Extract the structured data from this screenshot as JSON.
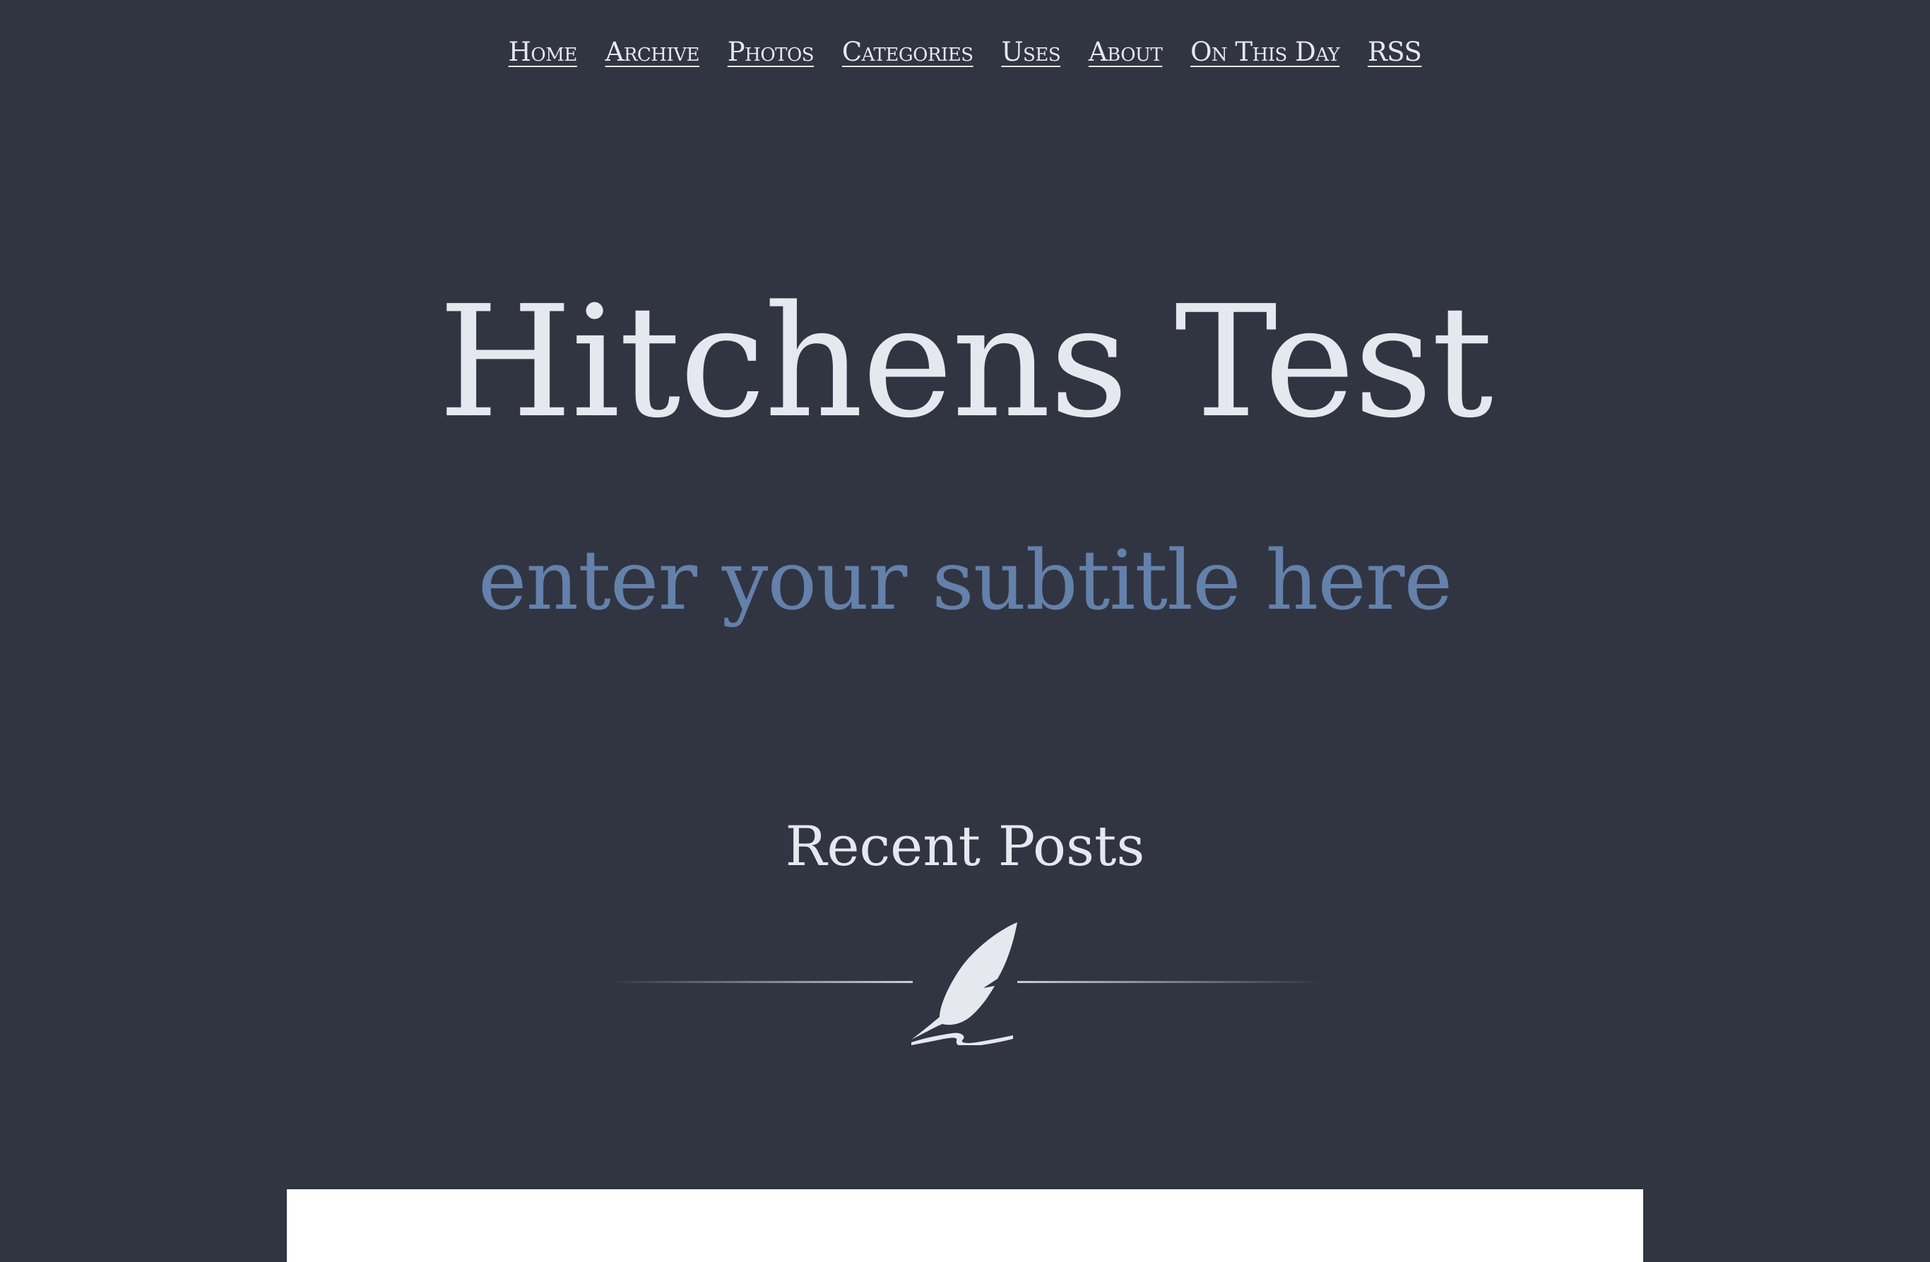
{
  "nav": {
    "items": [
      "Home",
      "Archive",
      "Photos",
      "Categories",
      "Uses",
      "About",
      "On This Day",
      "RSS"
    ]
  },
  "header": {
    "title": "Hitchens Test",
    "subtitle": "enter your subtitle here"
  },
  "recent": {
    "heading": "Recent Posts",
    "icon": "quill-pen-icon"
  },
  "colors": {
    "background": "#313542",
    "text": "#e6e8f0",
    "subtitle": "#6481ab",
    "card": "#ffffff"
  }
}
